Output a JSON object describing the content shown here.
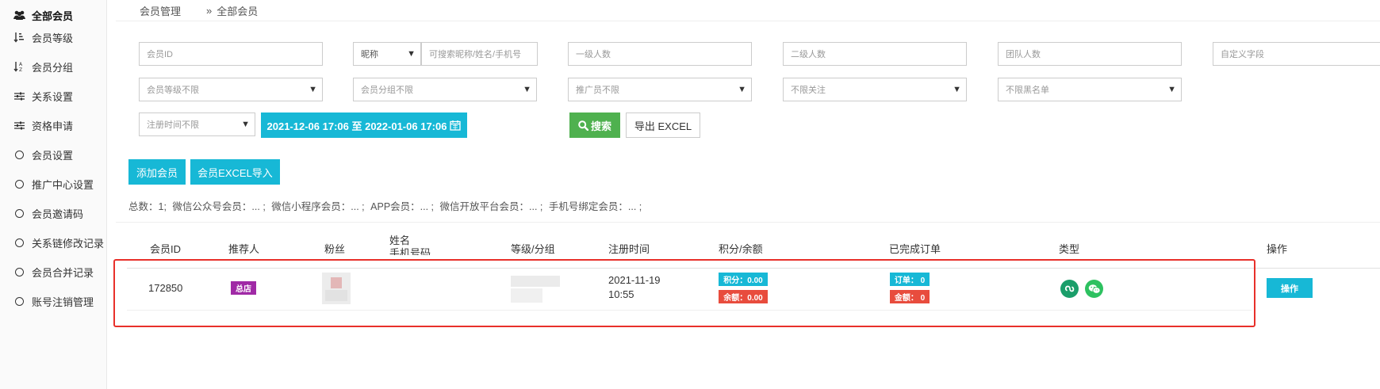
{
  "sidebar": {
    "items": [
      {
        "label": "全部会员",
        "icon": "users-icon"
      },
      {
        "label": "会员等级",
        "icon": "sort-list-icon"
      },
      {
        "label": "会员分组",
        "icon": "sort-alpha-icon"
      },
      {
        "label": "关系设置",
        "icon": "sliders-icon"
      },
      {
        "label": "资格申请",
        "icon": "sliders-icon"
      },
      {
        "label": "会员设置",
        "icon": "circle-icon"
      },
      {
        "label": "推广中心设置",
        "icon": "circle-icon"
      },
      {
        "label": "会员邀请码",
        "icon": "circle-icon"
      },
      {
        "label": "关系链修改记录",
        "icon": "circle-icon"
      },
      {
        "label": "会员合并记录",
        "icon": "circle-icon"
      },
      {
        "label": "账号注销管理",
        "icon": "circle-icon"
      }
    ]
  },
  "breadcrumb": {
    "parent": "会员管理",
    "separator": "»",
    "current": "全部会员"
  },
  "filters": {
    "member_id_placeholder": "会员ID",
    "nickname_select": "昵称",
    "search_placeholder": "可搜索昵称/姓名/手机号",
    "level1_placeholder": "一级人数",
    "level2_placeholder": "二级人数",
    "team_placeholder": "团队人数",
    "custom_placeholder": "自定义字段",
    "member_level_select": "会员等级不限",
    "member_group_select": "会员分组不限",
    "promoter_select": "推广员不限",
    "follow_select": "不限关注",
    "blacklist_select": "不限黑名单",
    "register_time_select": "注册时间不限",
    "date_range": "2021-12-06 17:06 至 2022-01-06 17:06",
    "search_button": "搜索",
    "export_button": "导出 EXCEL"
  },
  "actions": {
    "add_member": "添加会员",
    "import_excel": "会员EXCEL导入"
  },
  "stats": {
    "total": "总数：1;",
    "wechat_official": "微信公众号会员：... ;",
    "wechat_mini": "微信小程序会员：... ;",
    "app": "APP会员：... ;",
    "wechat_open": "微信开放平台会员：... ;",
    "phone_bound": "手机号绑定会员：... ;"
  },
  "table": {
    "headers": {
      "member_id": "会员ID",
      "referrer": "推荐人",
      "fans": "粉丝",
      "name": "姓名",
      "phone": "手机号码",
      "level_group": "等级/分组",
      "register_time": "注册时间",
      "points_balance": "积分/余额",
      "orders": "已完成订单",
      "type": "类型",
      "operation": "操作"
    },
    "rows": [
      {
        "member_id": "172850",
        "referrer": "总店",
        "register_date": "2021-11-19",
        "register_clock": "10:55",
        "points": "积分：0.00",
        "balance": "余额：0.00",
        "orders": "订单： 0",
        "amount": "金额： 0",
        "type_icons": [
          "mini-program-icon",
          "wechat-icon"
        ],
        "action": "操作"
      }
    ]
  },
  "colors": {
    "accent_cyan": "#17b8d6",
    "search_green": "#4fb14f",
    "tag_purple": "#a02aa6",
    "tag_red": "#e84c3d",
    "highlight_red": "#e8302a"
  }
}
